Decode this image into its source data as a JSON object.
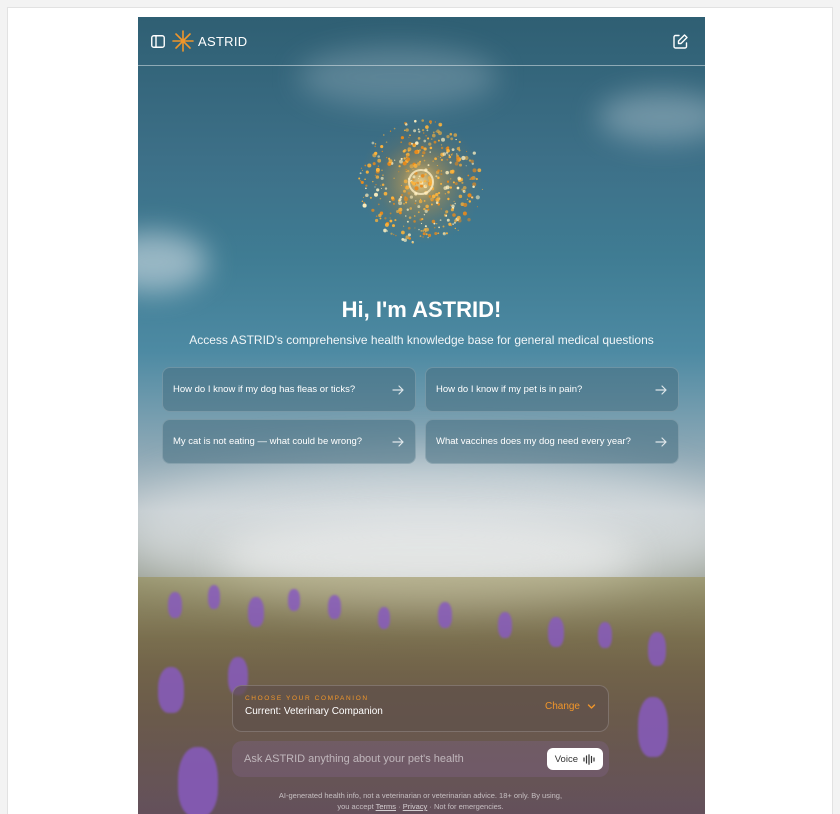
{
  "header": {
    "brand": "ASTRID"
  },
  "hero": {
    "title": "Hi, I'm ASTRID!",
    "subtitle": "Access ASTRID's comprehensive health knowledge base for general medical questions"
  },
  "suggestions": [
    {
      "label": "How do I know if my dog has fleas or ticks?"
    },
    {
      "label": "How do I know if my pet is in pain?"
    },
    {
      "label": "My cat is not eating — what could be wrong?"
    },
    {
      "label": "What vaccines does my dog need every year?"
    }
  ],
  "companion": {
    "kicker": "CHOOSE YOUR COMPANION",
    "current": "Current: Veterinary Companion",
    "change_label": "Change"
  },
  "composer": {
    "placeholder": "Ask ASTRID anything about your pet's health",
    "voice_label": "Voice"
  },
  "footer": {
    "line1": "AI-generated health info, not a veterinarian or veterinarian advice. 18+ only. By using,",
    "prefix": "you accept",
    "terms": "Terms",
    "sep1": "·",
    "privacy": "Privacy",
    "sep2": "·",
    "suffix": "Not for emergencies."
  },
  "colors": {
    "accent": "#f0962a",
    "sky": "#3d7088",
    "card": "#466e80"
  },
  "icons": {
    "sidebar": "sidebar-panel-icon",
    "logo": "star-burst-logo-icon",
    "new_chat": "edit-square-icon",
    "arrow": "arrow-right-icon",
    "chevron": "chevron-down-icon",
    "voice": "waveform-icon"
  }
}
